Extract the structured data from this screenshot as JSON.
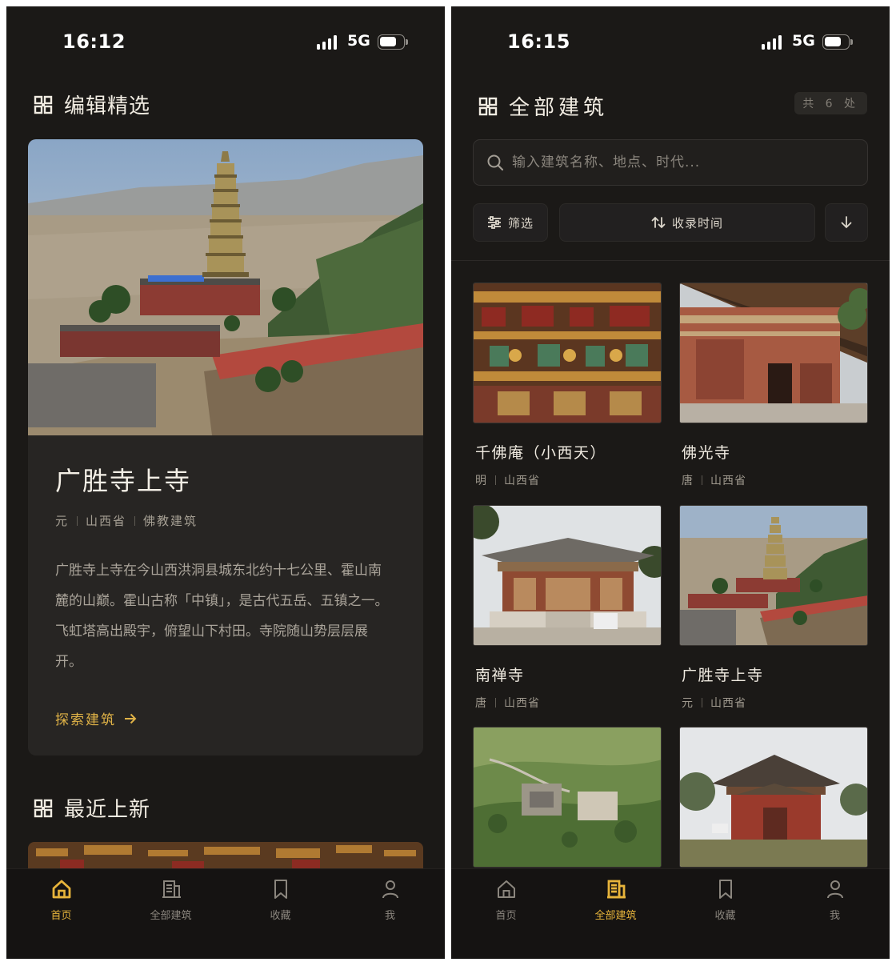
{
  "left_screen": {
    "status": {
      "time": "16:12",
      "network": "5G"
    },
    "section1_title": "编辑精选",
    "featured": {
      "title": "广胜寺上寺",
      "meta": [
        "元",
        "山西省",
        "佛教建筑"
      ],
      "description": "广胜寺上寺在今山西洪洞县城东北约十七公里、霍山南麓的山巅。霍山古称「中镇」，是古代五岳、五镇之一。飞虹塔高出殿宇，俯望山下村田。寺院随山势层层展开。",
      "explore_label": "探索建筑"
    },
    "section2_title": "最近上新"
  },
  "right_screen": {
    "status": {
      "time": "16:15",
      "network": "5G"
    },
    "title": "全部建筑",
    "count": "共 6 处",
    "search_placeholder": "输入建筑名称、地点、时代...",
    "filter_label": "筛选",
    "sort_label": "收录时间",
    "items": [
      {
        "name": "千佛庵（小西天）",
        "era": "明",
        "province": "山西省"
      },
      {
        "name": "佛光寺",
        "era": "唐",
        "province": "山西省"
      },
      {
        "name": "南禅寺",
        "era": "唐",
        "province": "山西省"
      },
      {
        "name": "广胜寺上寺",
        "era": "元",
        "province": "山西省"
      }
    ]
  },
  "tabs": [
    {
      "label": "首页",
      "icon": "home-icon"
    },
    {
      "label": "全部建筑",
      "icon": "building-icon"
    },
    {
      "label": "收藏",
      "icon": "bookmark-icon"
    },
    {
      "label": "我",
      "icon": "person-icon"
    }
  ],
  "colors": {
    "accent": "#e7b43b",
    "background": "#1b1917",
    "card": "#272523"
  }
}
